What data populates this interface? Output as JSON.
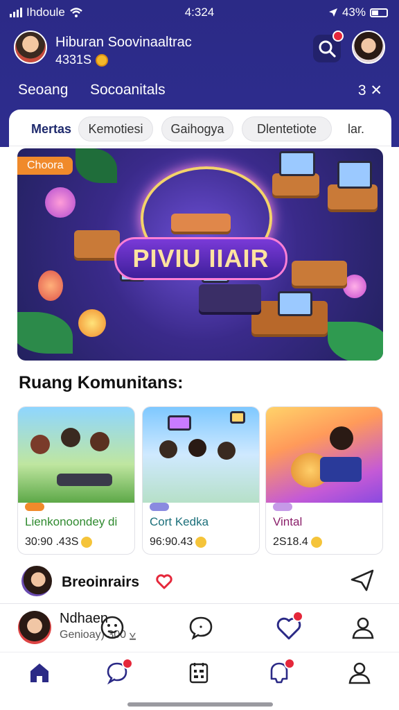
{
  "status_bar": {
    "carrier": "Ihdoule",
    "time": "4:324",
    "battery": "43%"
  },
  "profile": {
    "name": "Hiburan Soovinaaltrac",
    "coins": "4331S"
  },
  "subnav": {
    "left": "Seoang",
    "middle": "Socoanitals",
    "right": "3 ✕"
  },
  "tabs": [
    {
      "label": "Mertas",
      "active": true
    },
    {
      "label": "Kemotiesi",
      "active": false
    },
    {
      "label": "Gaihogya",
      "active": false
    },
    {
      "label": "Dlentetiote",
      "active": false
    },
    {
      "label": "lar.",
      "active": false
    }
  ],
  "banner": {
    "tag": "Choora",
    "title": "PIVIU IIAIR"
  },
  "section_title": "Ruang Komunitans:",
  "rooms": [
    {
      "name": "Lienkonoondey di",
      "meta": "30:90 .43S",
      "name_color": "#2f8a2f"
    },
    {
      "name": "Cort Kedka",
      "meta": "96:90.43",
      "name_color": "#1b6f7a"
    },
    {
      "name": "Vintal",
      "meta": "2S18.4",
      "name_color": "#8a1f6a"
    }
  ],
  "feed": {
    "name": "Breoinrairs"
  },
  "action_bar": {
    "name": "Ndhaen",
    "sub": "Genioay) 300 ⩣"
  },
  "colors": {
    "header": "#2b2a86",
    "accent": "#e5273a",
    "nav": "#2b2a86"
  }
}
